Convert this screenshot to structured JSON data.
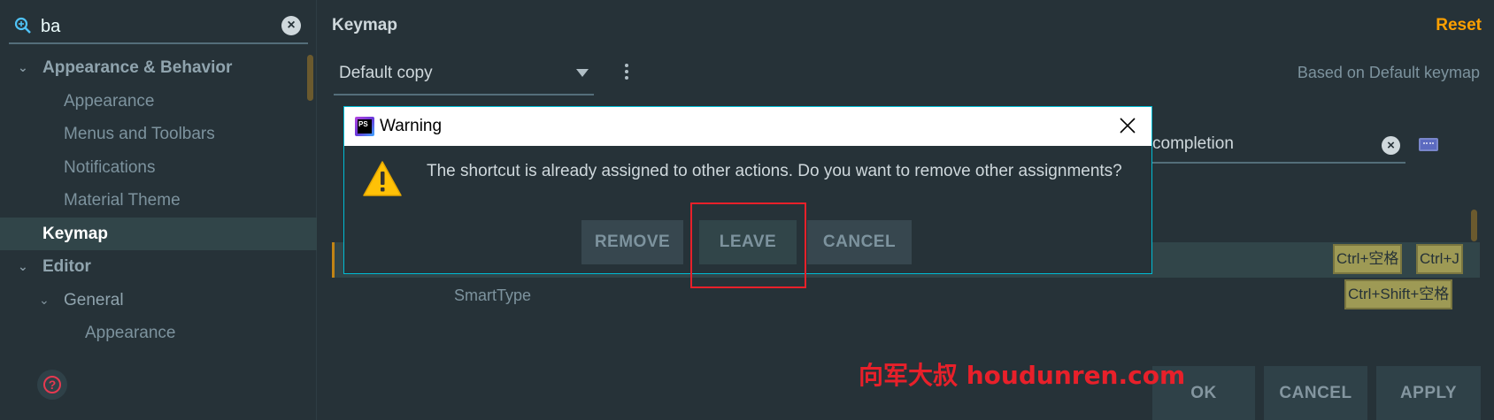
{
  "search": {
    "value": "ba"
  },
  "tree": [
    {
      "label": "Appearance & Behavior",
      "level": 0,
      "expanded": true
    },
    {
      "label": "Appearance",
      "level": 1
    },
    {
      "label": "Menus and Toolbars",
      "level": 1
    },
    {
      "label": "Notifications",
      "level": 1
    },
    {
      "label": "Material Theme",
      "level": 1
    },
    {
      "label": "Keymap",
      "level": 0,
      "selected": true
    },
    {
      "label": "Editor",
      "level": 0,
      "expanded": true
    },
    {
      "label": "General",
      "level": 1,
      "expanded": true
    },
    {
      "label": "Appearance",
      "level": 2
    }
  ],
  "header": {
    "title": "Keymap",
    "reset": "Reset"
  },
  "keymap": {
    "selected": "Default copy",
    "based_on": "Based on Default keymap"
  },
  "filter": {
    "value": "completion"
  },
  "rows": {
    "highlighted_shortcuts": [
      "Ctrl+空格",
      "Ctrl+J"
    ],
    "smart_label": "SmartType",
    "smart_shortcut": "Ctrl+Shift+空格"
  },
  "footer": {
    "ok": "OK",
    "cancel": "CANCEL",
    "apply": "APPLY"
  },
  "dialog": {
    "title": "Warning",
    "app_badge": "PS",
    "message": "The shortcut is already assigned to other actions. Do you want to remove other assignments?",
    "remove": "REMOVE",
    "leave": "LEAVE",
    "cancel": "CANCEL"
  },
  "watermark": "向军大叔  houdunren.com",
  "colors": {
    "accent": "#FFA000",
    "dialog_border": "#00BCD4",
    "highlight": "#E8202A",
    "shortcut_bg": "#9e9a55"
  }
}
